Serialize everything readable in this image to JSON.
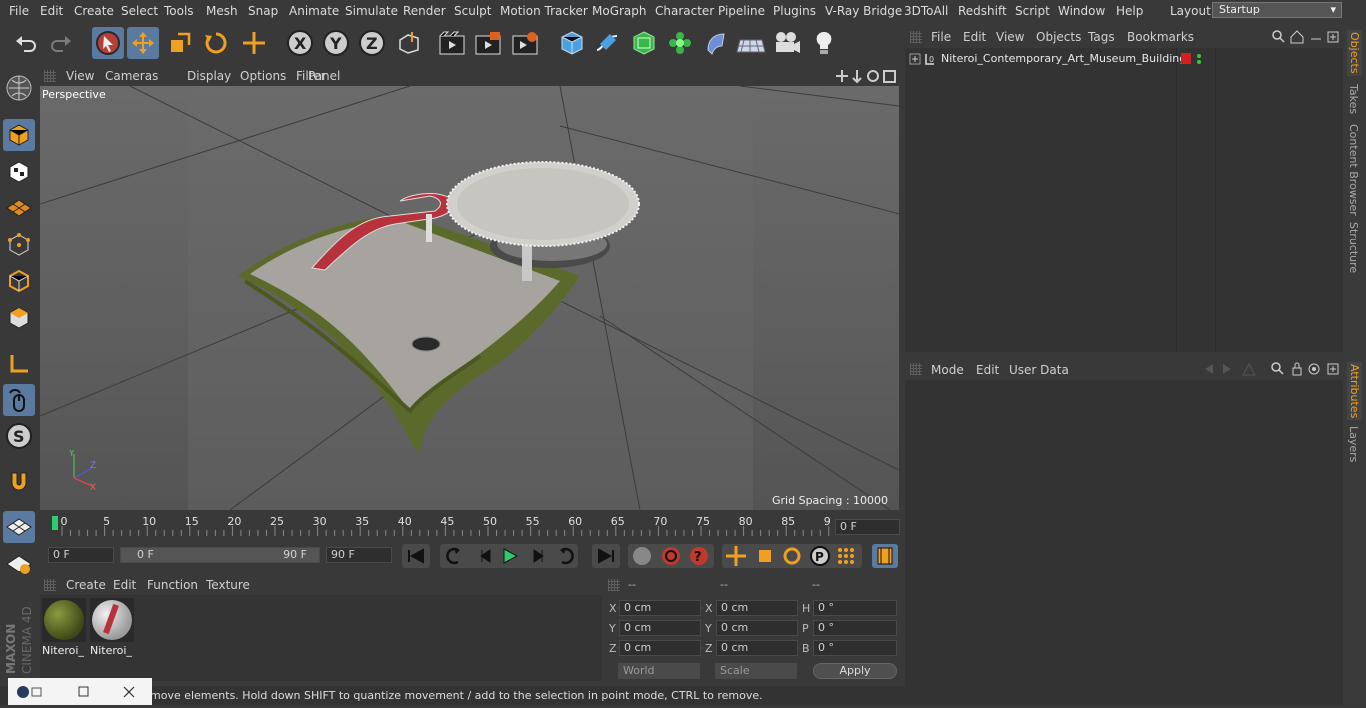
{
  "menubar": {
    "items": [
      "File",
      "Edit",
      "Create",
      "Select",
      "Tools",
      "Mesh",
      "Snap",
      "Animate",
      "Simulate",
      "Render",
      "Sculpt",
      "Motion Tracker",
      "MoGraph",
      "Character",
      "Pipeline",
      "Plugins",
      "V-Ray Bridge",
      "3DToAll",
      "Redshift",
      "Script",
      "Window",
      "Help"
    ],
    "layout_label": "Layout:",
    "layout_value": "Startup"
  },
  "viewport": {
    "menu": [
      "View",
      "Cameras",
      "Display",
      "Options",
      "Filter",
      "Panel"
    ],
    "label": "Perspective",
    "grid_spacing": "Grid Spacing : 10000 cm"
  },
  "timeline": {
    "ticks": [
      "0",
      "5",
      "10",
      "15",
      "20",
      "25",
      "30",
      "35",
      "40",
      "45",
      "50",
      "55",
      "60",
      "65",
      "70",
      "75",
      "80",
      "85",
      "90"
    ],
    "current_frame": "0 F",
    "start": "0 F",
    "range_start": "0 F",
    "range_end": "90 F",
    "end": "90 F"
  },
  "materials": {
    "menu": [
      "Create",
      "Edit",
      "Function",
      "Texture"
    ],
    "items": [
      {
        "name": "Niteroi_"
      },
      {
        "name": "Niteroi_"
      }
    ]
  },
  "coordinates": {
    "headers": [
      "--",
      "--",
      "--"
    ],
    "rows": [
      {
        "a": "X",
        "av": "0 cm",
        "b": "X",
        "bv": "0 cm",
        "c": "H",
        "cv": "0 °"
      },
      {
        "a": "Y",
        "av": "0 cm",
        "b": "Y",
        "bv": "0 cm",
        "c": "P",
        "cv": "0 °"
      },
      {
        "a": "Z",
        "av": "0 cm",
        "b": "Z",
        "bv": "0 cm",
        "c": "B",
        "cv": "0 °"
      }
    ],
    "world": "World",
    "scale": "Scale",
    "apply": "Apply"
  },
  "status": "move elements. Hold down SHIFT to quantize movement / add to the selection in point mode, CTRL to remove.",
  "objects": {
    "menu": [
      "File",
      "Edit",
      "View",
      "Objects",
      "Tags",
      "Bookmarks"
    ],
    "tree": [
      {
        "name": "Niteroi_Contemporary_Art_Museum_Building"
      }
    ]
  },
  "attributes": {
    "menu": [
      "Mode",
      "Edit",
      "User Data"
    ]
  },
  "right_tabs": [
    "Objects",
    "Takes",
    "Content Browser",
    "Structure",
    "Attributes",
    "Layers"
  ],
  "brand": {
    "line1": "MAXON",
    "line2": "CINEMA 4D"
  }
}
